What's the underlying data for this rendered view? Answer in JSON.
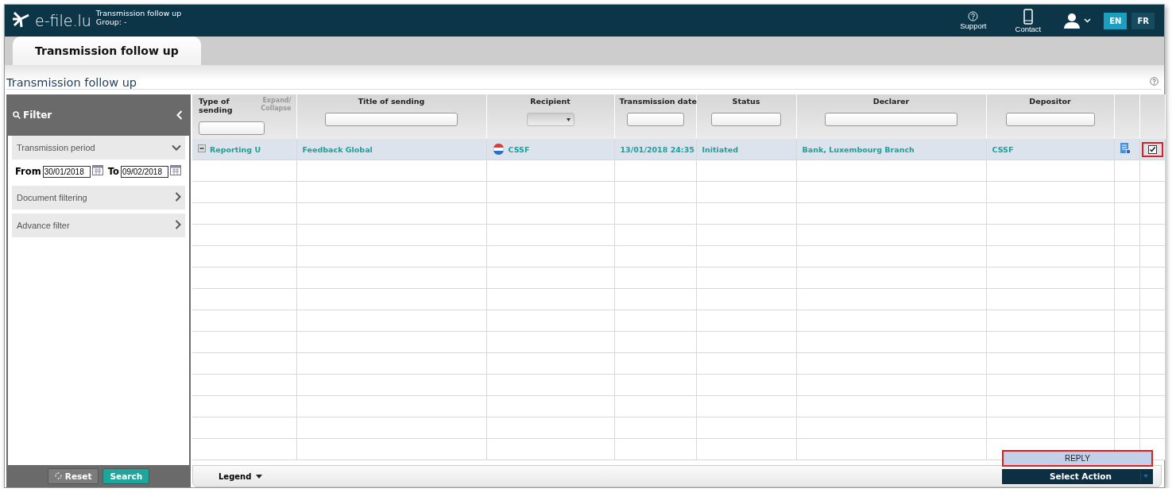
{
  "header": {
    "logo": "e-file.lu",
    "context": "Transmission follow up",
    "group": "Group: -",
    "nav": [
      {
        "kind": "support",
        "label": "Support"
      },
      {
        "kind": "contact",
        "label": "Contact"
      }
    ],
    "languages": [
      {
        "label": "EN",
        "selected": true
      },
      {
        "label": "FR",
        "selected": false
      }
    ]
  },
  "tabs": [
    {
      "label": "Transmission follow up",
      "selected": true
    }
  ],
  "page_title": "Transmission follow up",
  "filter": {
    "title": "Filter",
    "sections": [
      {
        "label": "Transmission period",
        "expanded": true
      },
      {
        "label": "Document filtering",
        "expanded": false
      },
      {
        "label": "Advance filter",
        "expanded": false
      }
    ],
    "from_label": "From",
    "from_value": "30/01/2018",
    "to_label": "To",
    "to_value": "09/02/2018",
    "reset": "Reset",
    "search": "Search"
  },
  "table": {
    "expand_collapse": "Expand/ Collapse",
    "columns": [
      {
        "label": "Type of sending",
        "kind": "text"
      },
      {
        "label": "Title of sending",
        "kind": "text"
      },
      {
        "label": "Recipient",
        "kind": "select"
      },
      {
        "label": "Transmission date",
        "kind": "text"
      },
      {
        "label": "Status",
        "kind": "text"
      },
      {
        "label": "Declarer",
        "kind": "text"
      },
      {
        "label": "Depositor",
        "kind": "text"
      }
    ],
    "rows": [
      {
        "selected": true,
        "expanded": true,
        "checked": true,
        "highlighted": true,
        "cells": [
          "Reporting U",
          "Feedback Global",
          "CSSF",
          "13/01/2018 24:35",
          "Initiated",
          "Bank, Luxembourg Branch",
          "CSSF"
        ]
      }
    ]
  },
  "footer": {
    "legend": "Legend",
    "action": "Select Action",
    "menu": [
      {
        "label": "REPLY",
        "highlighted": true
      }
    ]
  }
}
